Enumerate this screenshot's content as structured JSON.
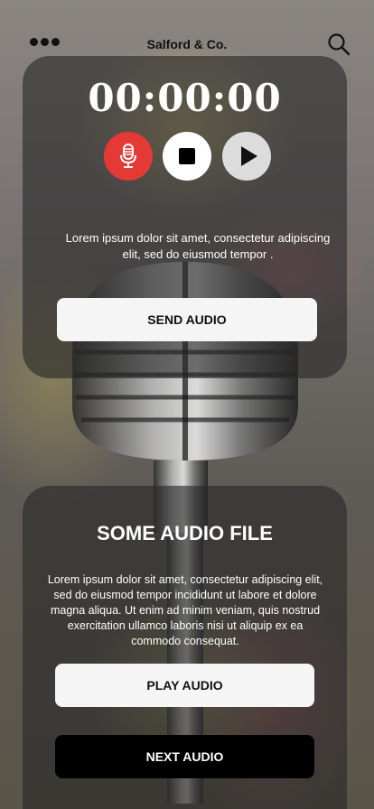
{
  "header": {
    "brand": "Salford & Co.",
    "menu_icon": "more-dots-icon",
    "search_icon": "search-icon"
  },
  "recorder": {
    "timer": "00:00:00",
    "record_icon": "microphone-icon",
    "stop_icon": "stop-icon",
    "play_icon": "play-icon",
    "description": "Lorem ipsum dolor sit amet, consectetur adipiscing elit, sed do eiusmod tempor .",
    "send_label": "SEND AUDIO",
    "record_color": "#e53935"
  },
  "audio_file": {
    "title": "SOME AUDIO FILE",
    "description": "Lorem ipsum dolor sit amet, consectetur adipiscing elit, sed do eiusmod tempor incididunt ut labore et dolore magna aliqua. Ut enim ad minim veniam, quis nostrud exercitation ullamco laboris nisi ut aliquip ex ea commodo consequat.",
    "play_label": "PLAY AUDIO",
    "next_label": "NEXT AUDIO"
  }
}
